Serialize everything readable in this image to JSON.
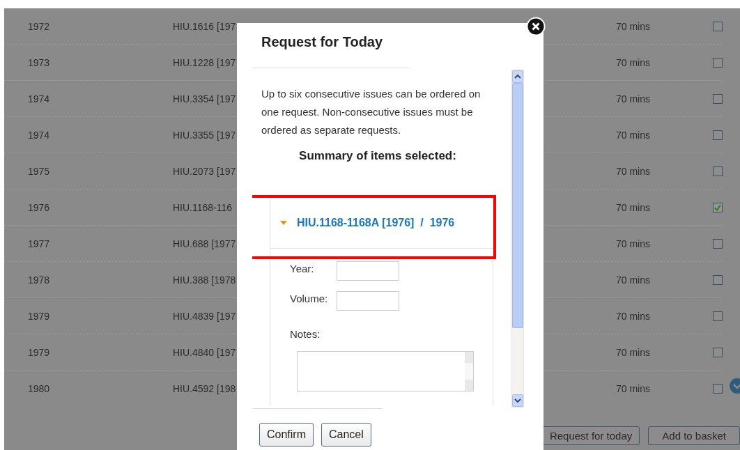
{
  "rows": [
    {
      "year": "1972",
      "call_number": "HIU.1616 [197",
      "time": "70 mins",
      "selected": false
    },
    {
      "year": "1973",
      "call_number": "HIU.1228 [197",
      "time": "70 mins",
      "selected": false
    },
    {
      "year": "1974",
      "call_number": "HIU.3354 [197",
      "time": "70 mins",
      "selected": false
    },
    {
      "year": "1974",
      "call_number": "HIU.3355 [197",
      "time": "70 mins",
      "selected": false
    },
    {
      "year": "1975",
      "call_number": "HIU.2073 [197",
      "time": "70 mins",
      "selected": false
    },
    {
      "year": "1976",
      "call_number": "HIU.1168-116",
      "time": "70 mins",
      "selected": true
    },
    {
      "year": "1977",
      "call_number": "HIU.688 [1977",
      "time": "70 mins",
      "selected": false
    },
    {
      "year": "1978",
      "call_number": "HIU.388 [1978",
      "time": "70 mins",
      "selected": false
    },
    {
      "year": "1979",
      "call_number": "HIU.4839 [197",
      "time": "70 mins",
      "selected": false
    },
    {
      "year": "1979",
      "call_number": "HIU.4840 [197",
      "time": "70 mins",
      "selected": false
    },
    {
      "year": "1980",
      "call_number": "HIU.4592 [198",
      "time": "70 mins",
      "selected": false
    }
  ],
  "buttons": [
    "Request for today",
    "Add to basket"
  ],
  "dialog": {
    "title": "Request for Today",
    "intro": "Up to six consecutive issues can be ordered on one request. Non-consecutive issues must be ordered as separate requests.",
    "summary_heading": "Summary of items selected:",
    "item": {
      "title": "HIU.1168-1168A [1976]  /  1976",
      "expanded": true,
      "highlighted": true
    },
    "fields": [
      {
        "label": "Year:",
        "kind": "text"
      },
      {
        "label": "Volume:",
        "kind": "text"
      },
      {
        "label": "Notes:",
        "kind": "textarea"
      }
    ],
    "buttons": [
      "Confirm",
      "Cancel"
    ]
  }
}
